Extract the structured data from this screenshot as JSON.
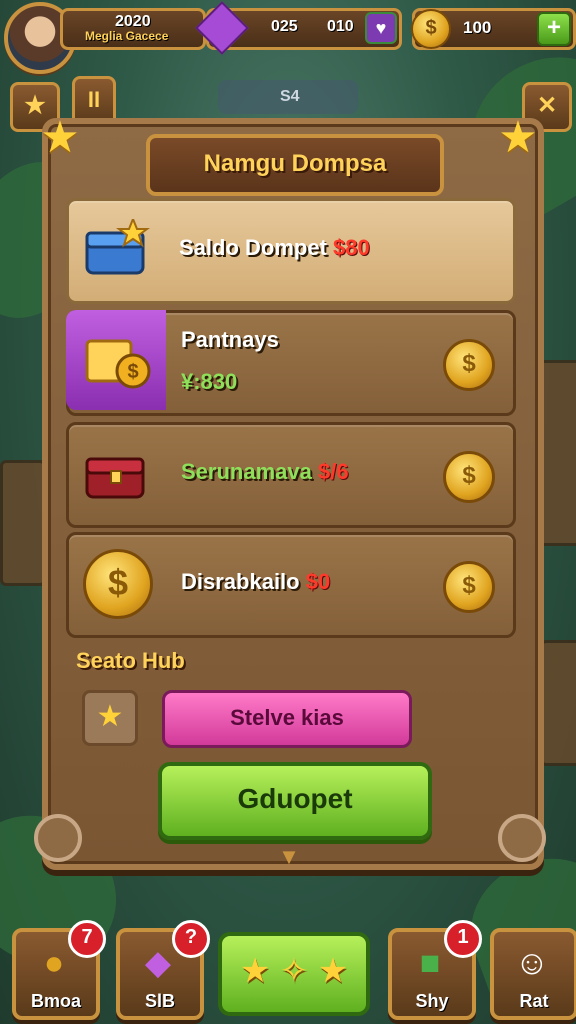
{
  "hud": {
    "level": "2020",
    "player_name": "Meglia Gacece",
    "gem_value_1": "025",
    "gem_value_2": "010",
    "coins": "100",
    "sub_value": "S4",
    "plus_label": "+",
    "pause_label": "II"
  },
  "panel": {
    "title": "Namgu Dompsa",
    "rows": [
      {
        "label": "Saldo Dompet",
        "amount": "$80"
      },
      {
        "label": "Pantnays",
        "amount": "¥:830"
      },
      {
        "label": "Serunamava",
        "amount": "$/6"
      },
      {
        "label": "Disrabkailo",
        "amount": "$0"
      }
    ],
    "section_title": "Seato Hub",
    "pink_button": "Stelve kias",
    "green_button": "Gduopet"
  },
  "bottom_nav": [
    {
      "label": "Bmoa",
      "badge": "7"
    },
    {
      "label": "SlB",
      "badge": "?"
    },
    {
      "label": "Shy",
      "badge": "1"
    },
    {
      "label": "Rat"
    }
  ],
  "colors": {
    "accent_gold": "#ffd25a",
    "wood": "#8e6a45",
    "green": "#5fb020",
    "pink": "#d23a9a",
    "red_amount": "#ff3a2a"
  },
  "icons": {
    "avatar": "avatar-icon",
    "gem": "gem-icon",
    "coin": "coin-icon",
    "star": "star-icon",
    "chest": "chest-icon",
    "cash": "cash-icon",
    "chef": "chef-icon"
  }
}
